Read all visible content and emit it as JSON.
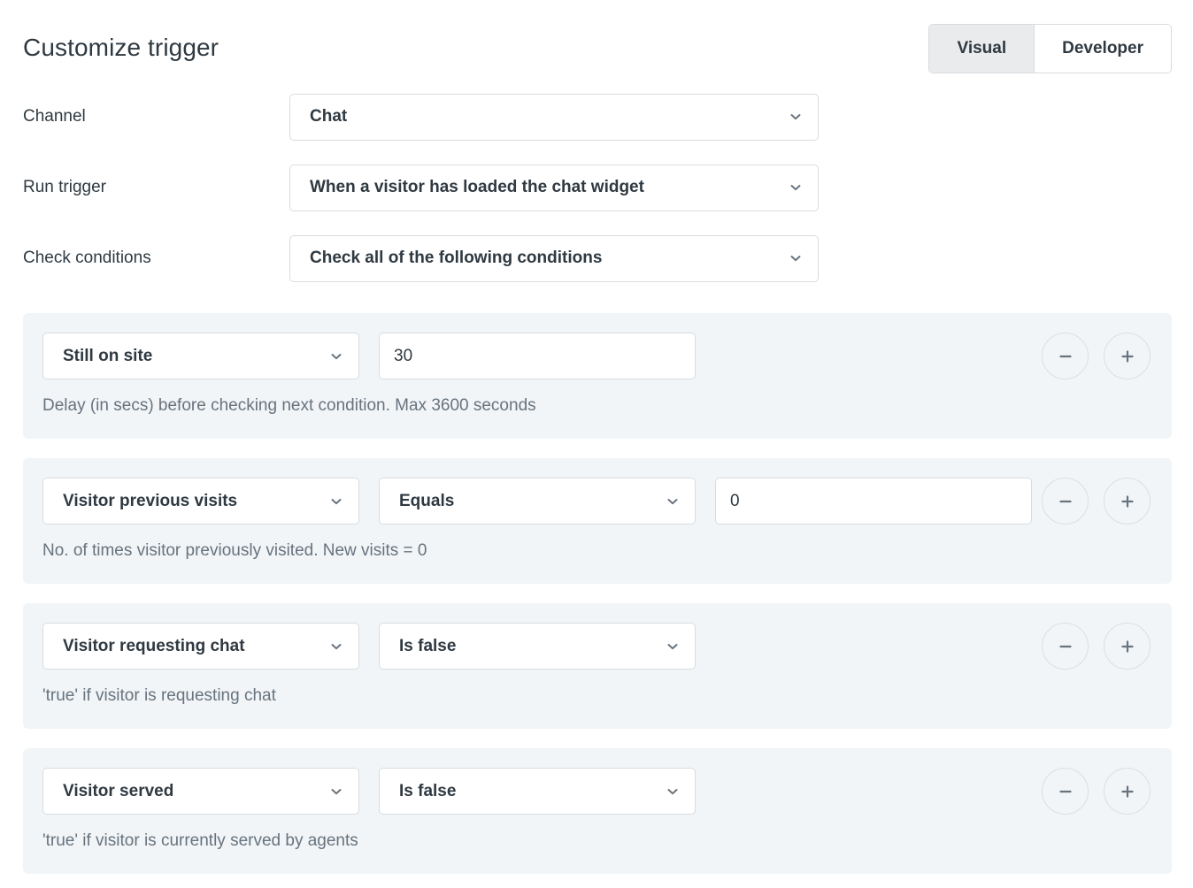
{
  "header": {
    "title": "Customize trigger",
    "mode_toggle": {
      "visual_label": "Visual",
      "developer_label": "Developer",
      "selected": "Visual"
    }
  },
  "form": {
    "rows": [
      {
        "label": "Channel",
        "value": "Chat"
      },
      {
        "label": "Run trigger",
        "value": "When a visitor has loaded the chat widget"
      },
      {
        "label": "Check conditions",
        "value": "Check all of the following conditions"
      }
    ]
  },
  "conditions": [
    {
      "attribute": "Still on site",
      "operator": null,
      "value": "30",
      "helper": "Delay (in secs) before checking next condition. Max 3600 seconds",
      "remove_label": "minus-icon",
      "add_label": "plus-icon"
    },
    {
      "attribute": "Visitor previous visits",
      "operator": "Equals",
      "value": "0",
      "helper": "No. of times visitor previously visited. New visits = 0",
      "remove_label": "minus-icon",
      "add_label": "plus-icon"
    },
    {
      "attribute": "Visitor requesting chat",
      "operator": "Is false",
      "value": null,
      "helper": "'true' if visitor is requesting chat",
      "remove_label": "minus-icon",
      "add_label": "plus-icon"
    },
    {
      "attribute": "Visitor served",
      "operator": "Is false",
      "value": null,
      "helper": "'true' if visitor is currently served by agents",
      "remove_label": "minus-icon",
      "add_label": "plus-icon"
    }
  ],
  "colors": {
    "text_primary": "#2f3941",
    "text_muted": "#68737d",
    "border": "#d8dcde",
    "panel_bg": "#f1f5f8",
    "toggle_selected_bg": "#e9ebed",
    "surface": "#ffffff"
  }
}
